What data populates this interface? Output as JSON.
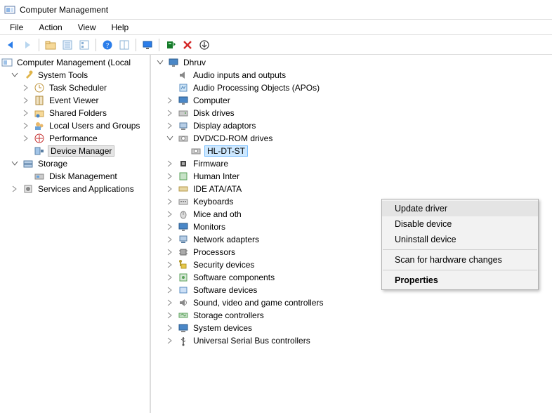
{
  "window": {
    "title": "Computer Management"
  },
  "menubar": {
    "items": [
      "File",
      "Action",
      "View",
      "Help"
    ]
  },
  "left_tree": {
    "root": "Computer Management (Local",
    "system_tools": {
      "label": "System Tools",
      "children": {
        "task_scheduler": "Task Scheduler",
        "event_viewer": "Event Viewer",
        "shared_folders": "Shared Folders",
        "local_users": "Local Users and Groups",
        "performance": "Performance",
        "device_manager": "Device Manager"
      }
    },
    "storage": {
      "label": "Storage",
      "children": {
        "disk_management": "Disk Management"
      }
    },
    "services": {
      "label": "Services and Applications"
    }
  },
  "right_tree": {
    "root": "Dhruv",
    "categories": {
      "audio_io": "Audio inputs and outputs",
      "apos": "Audio Processing Objects (APOs)",
      "computer": "Computer",
      "disk_drives": "Disk drives",
      "display": "Display adaptors",
      "dvd": "DVD/CD-ROM drives",
      "dvd_child": "HL-DT-ST",
      "firmware": "Firmware",
      "hid": "Human Inter",
      "ide": "IDE ATA/ATA",
      "keyboards": "Keyboards",
      "mice": "Mice and oth",
      "monitors": "Monitors",
      "network": "Network adapters",
      "processors": "Processors",
      "security": "Security devices",
      "sw_components": "Software components",
      "sw_devices": "Software devices",
      "sound": "Sound, video and game controllers",
      "storage_ctrl": "Storage controllers",
      "system_devices": "System devices",
      "usb": "Universal Serial Bus controllers"
    }
  },
  "context_menu": {
    "update": "Update driver",
    "disable": "Disable device",
    "uninstall": "Uninstall device",
    "scan": "Scan for hardware changes",
    "properties": "Properties"
  }
}
